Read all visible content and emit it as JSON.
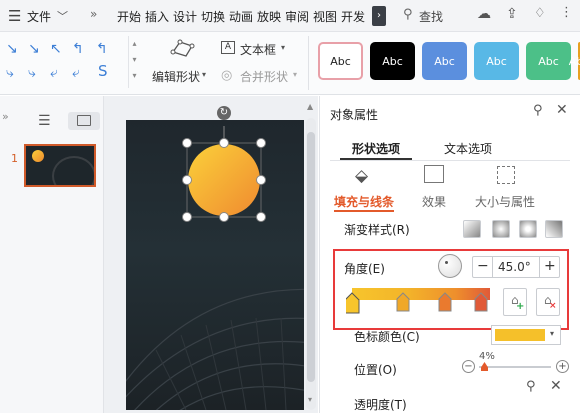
{
  "menubar": {
    "file_label": "文件",
    "items": [
      "开始",
      "插入",
      "设计",
      "切换",
      "动画",
      "放映",
      "审阅",
      "视图",
      "开发"
    ],
    "search_label": "查找"
  },
  "ribbon": {
    "edit_shape_label": "编辑形状",
    "textbox_label": "文本框",
    "merge_shape_label": "合并形状",
    "style_label": "Abc",
    "style_colors": [
      "#ffffff",
      "#000000",
      "#5b8fde",
      "#58b8e6",
      "#4cc088",
      "#e8a020"
    ]
  },
  "thumbnails": {
    "slide_number": "1"
  },
  "panel": {
    "title": "对象属性",
    "tabs": [
      "形状选项",
      "文本选项"
    ],
    "subtabs": [
      "填充与线条",
      "效果",
      "大小与属性"
    ],
    "gradient_style_label": "渐变样式(R)",
    "angle_label": "角度(E)",
    "angle_value": "45.0°",
    "stop_color_label": "色标颜色(C)",
    "stop_color": "#f5c02a",
    "position_label": "位置(O)",
    "position_value": "4%",
    "transparency_label": "透明度(T)",
    "gradient_stop_colors": [
      "#f7c52c",
      "#f0a828",
      "#ea7a2e",
      "#e05a38"
    ]
  },
  "colors": {
    "accent": "#e83a3a",
    "tab_accent": "#e35a2b"
  }
}
